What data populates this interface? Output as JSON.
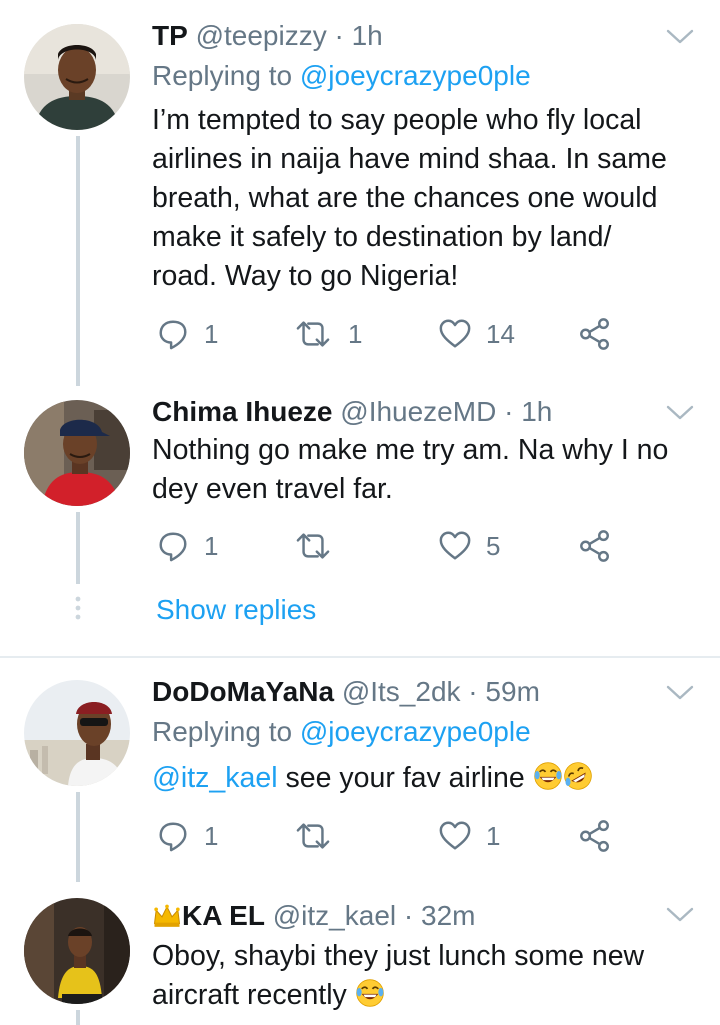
{
  "tweets": [
    {
      "name": "TP",
      "handle": "@teepizzy",
      "time": "1h",
      "replying_prefix": "Replying to",
      "replying_to": "@joeycrazype0ple",
      "lines": [
        "I’m tempted to say people who fly local",
        "airlines in naija have mind shaa. In same",
        "breath, what are the chances one would",
        "make it safely to destination by land/",
        "road. Way to go Nigeria!"
      ],
      "replies": "1",
      "retweets": "1",
      "likes": "14",
      "avatar_icon": "avatar-man-green-hoodie"
    },
    {
      "name": "Chima Ihueze",
      "handle": "@IhuezeMD",
      "time": "1h",
      "lines": [
        "Nothing go make me try am. Na why I no",
        "dey even travel far."
      ],
      "replies": "1",
      "retweets": "",
      "likes": "5",
      "avatar_icon": "avatar-man-red-shirt-cap"
    },
    {
      "name": "DoDoMaYaNa",
      "handle": "@Its_2dk",
      "time": "59m",
      "replying_prefix": "Replying to",
      "replying_to": "@joeycrazype0ple",
      "mention": "@itz_kael",
      "text_after_mention": " see your fav airline",
      "replies": "1",
      "retweets": "",
      "likes": "1",
      "avatar_icon": "avatar-man-sunglasses-outdoor"
    },
    {
      "name": "KA EL",
      "handle": "@itz_kael",
      "time": "32m",
      "lines": [
        "Oboy, shaybi they just lunch some new",
        "aircraft recently"
      ],
      "avatar_icon": "avatar-man-yellow-shirt-seated"
    }
  ],
  "show_replies": "Show replies",
  "icons": {
    "reply": "reply-icon",
    "retweet": "retweet-icon",
    "like": "like-icon",
    "share": "share-icon",
    "chevron": "chevron-down-icon",
    "crown": "crown-emoji",
    "laugh": "laughing-emoji",
    "rofl": "rolling-laughing-emoji"
  },
  "colors": {
    "link": "#1da1f2",
    "secondary": "#657786",
    "text": "#14171a",
    "icon": "#657786",
    "thread": "#ccd6dd"
  }
}
